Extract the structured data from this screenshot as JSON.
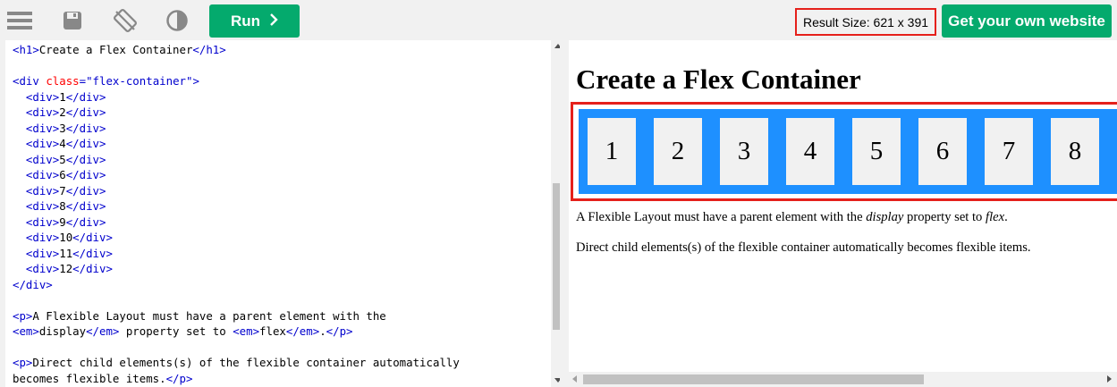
{
  "toolbar": {
    "icons": [
      "menu-icon",
      "save-icon",
      "rotate-orientation-icon",
      "theme-contrast-icon"
    ],
    "run_label": "Run",
    "result_size": "Result Size: 621 x 391",
    "own_website_label": "Get your own website"
  },
  "editor": {
    "lines": [
      [
        {
          "c": "t-tag",
          "t": "<h1>"
        },
        {
          "c": "",
          "t": "Create a Flex Container"
        },
        {
          "c": "t-tag",
          "t": "</h1>"
        }
      ],
      [],
      [
        {
          "c": "t-tag",
          "t": "<div "
        },
        {
          "c": "t-attr",
          "t": "class"
        },
        {
          "c": "t-tag",
          "t": "="
        },
        {
          "c": "t-val",
          "t": "\"flex-container\""
        },
        {
          "c": "t-tag",
          "t": ">"
        }
      ],
      [
        {
          "c": "",
          "t": "  "
        },
        {
          "c": "t-tag",
          "t": "<div>"
        },
        {
          "c": "",
          "t": "1"
        },
        {
          "c": "t-tag",
          "t": "</div>"
        }
      ],
      [
        {
          "c": "",
          "t": "  "
        },
        {
          "c": "t-tag",
          "t": "<div>"
        },
        {
          "c": "",
          "t": "2"
        },
        {
          "c": "t-tag",
          "t": "</div>"
        }
      ],
      [
        {
          "c": "",
          "t": "  "
        },
        {
          "c": "t-tag",
          "t": "<div>"
        },
        {
          "c": "",
          "t": "3"
        },
        {
          "c": "t-tag",
          "t": "</div>"
        }
      ],
      [
        {
          "c": "",
          "t": "  "
        },
        {
          "c": "t-tag",
          "t": "<div>"
        },
        {
          "c": "",
          "t": "4"
        },
        {
          "c": "t-tag",
          "t": "</div>"
        }
      ],
      [
        {
          "c": "",
          "t": "  "
        },
        {
          "c": "t-tag",
          "t": "<div>"
        },
        {
          "c": "",
          "t": "5"
        },
        {
          "c": "t-tag",
          "t": "</div>"
        }
      ],
      [
        {
          "c": "",
          "t": "  "
        },
        {
          "c": "t-tag",
          "t": "<div>"
        },
        {
          "c": "",
          "t": "6"
        },
        {
          "c": "t-tag",
          "t": "</div>"
        }
      ],
      [
        {
          "c": "",
          "t": "  "
        },
        {
          "c": "t-tag",
          "t": "<div>"
        },
        {
          "c": "",
          "t": "7"
        },
        {
          "c": "t-tag",
          "t": "</div>"
        }
      ],
      [
        {
          "c": "",
          "t": "  "
        },
        {
          "c": "t-tag",
          "t": "<div>"
        },
        {
          "c": "",
          "t": "8"
        },
        {
          "c": "t-tag",
          "t": "</div>"
        }
      ],
      [
        {
          "c": "",
          "t": "  "
        },
        {
          "c": "t-tag",
          "t": "<div>"
        },
        {
          "c": "",
          "t": "9"
        },
        {
          "c": "t-tag",
          "t": "</div>"
        }
      ],
      [
        {
          "c": "",
          "t": "  "
        },
        {
          "c": "t-tag",
          "t": "<div>"
        },
        {
          "c": "",
          "t": "10"
        },
        {
          "c": "t-tag",
          "t": "</div>"
        }
      ],
      [
        {
          "c": "",
          "t": "  "
        },
        {
          "c": "t-tag",
          "t": "<div>"
        },
        {
          "c": "",
          "t": "11"
        },
        {
          "c": "t-tag",
          "t": "</div>"
        }
      ],
      [
        {
          "c": "",
          "t": "  "
        },
        {
          "c": "t-tag",
          "t": "<div>"
        },
        {
          "c": "",
          "t": "12"
        },
        {
          "c": "t-tag",
          "t": "</div>"
        }
      ],
      [
        {
          "c": "t-tag",
          "t": "</div>"
        }
      ],
      [],
      [
        {
          "c": "t-tag",
          "t": "<p>"
        },
        {
          "c": "",
          "t": "A Flexible Layout must have a parent element with the"
        }
      ],
      [
        {
          "c": "t-tag",
          "t": "<em>"
        },
        {
          "c": "",
          "t": "display"
        },
        {
          "c": "t-tag",
          "t": "</em>"
        },
        {
          "c": "",
          "t": " property set to "
        },
        {
          "c": "t-tag",
          "t": "<em>"
        },
        {
          "c": "",
          "t": "flex"
        },
        {
          "c": "t-tag",
          "t": "</em>"
        },
        {
          "c": "",
          "t": "."
        },
        {
          "c": "t-tag",
          "t": "</p>"
        }
      ],
      [],
      [
        {
          "c": "t-tag",
          "t": "<p>"
        },
        {
          "c": "",
          "t": "Direct child elements(s) of the flexible container automatically"
        }
      ],
      [
        {
          "c": "",
          "t": "becomes flexible items."
        },
        {
          "c": "t-tag",
          "t": "</p>"
        }
      ]
    ]
  },
  "result": {
    "heading": "Create a Flex Container",
    "items": [
      "1",
      "2",
      "3",
      "4",
      "5",
      "6",
      "7",
      "8"
    ],
    "para1": {
      "before": "A Flexible Layout must have a parent element with the ",
      "em1": "display",
      "middle": " property set to ",
      "em2": "flex",
      "after": "."
    },
    "para2": "Direct child elements(s) of the flexible container automatically becomes flexible items."
  },
  "colors": {
    "accent_green": "#04aa6d",
    "highlight_red": "#e5201b",
    "flex_blue": "#1e90ff",
    "code_tag_blue": "#0000cd",
    "code_attr_red": "#ff0000"
  }
}
